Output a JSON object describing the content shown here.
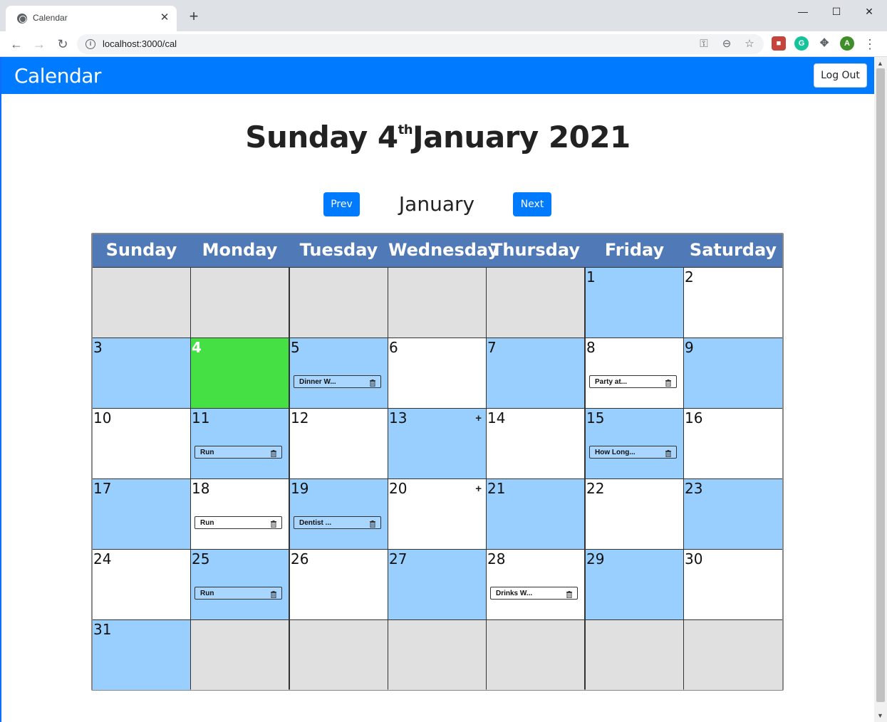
{
  "browser": {
    "tab_title": "Calendar",
    "tab_close": "✕",
    "new_tab": "+",
    "url": "localhost:3000/cal",
    "profile_initial": "A",
    "window": {
      "minimize": "—",
      "maximize": "☐",
      "close": "✕"
    }
  },
  "app": {
    "brand": "Calendar",
    "logout_label": "Log Out"
  },
  "heading": {
    "weekday": "Sunday",
    "day": "4",
    "ordinal": "th",
    "month_year": "January 2021"
  },
  "nav": {
    "prev_label": "Prev",
    "month": "January",
    "next_label": "Next"
  },
  "calendar": {
    "weekdays": [
      "Sunday",
      "Monday",
      "Tuesday",
      "Wednesday",
      "Thursday",
      "Friday",
      "Saturday"
    ],
    "add_symbol": "+",
    "weeks": [
      [
        {
          "day": "",
          "color": "grey"
        },
        {
          "day": "",
          "color": "grey"
        },
        {
          "day": "",
          "color": "grey"
        },
        {
          "day": "",
          "color": "grey"
        },
        {
          "day": "",
          "color": "grey"
        },
        {
          "day": "1",
          "color": "blue"
        },
        {
          "day": "2",
          "color": "white"
        }
      ],
      [
        {
          "day": "3",
          "color": "blue"
        },
        {
          "day": "4",
          "color": "green"
        },
        {
          "day": "5",
          "color": "blue",
          "event": "Dinner W..."
        },
        {
          "day": "6",
          "color": "white"
        },
        {
          "day": "7",
          "color": "blue"
        },
        {
          "day": "8",
          "color": "white",
          "event": "Party at..."
        },
        {
          "day": "9",
          "color": "blue"
        }
      ],
      [
        {
          "day": "10",
          "color": "white"
        },
        {
          "day": "11",
          "color": "blue",
          "event": "Run"
        },
        {
          "day": "12",
          "color": "white"
        },
        {
          "day": "13",
          "color": "blue",
          "plus": true
        },
        {
          "day": "14",
          "color": "white"
        },
        {
          "day": "15",
          "color": "blue",
          "event": "How Long..."
        },
        {
          "day": "16",
          "color": "white"
        }
      ],
      [
        {
          "day": "17",
          "color": "blue"
        },
        {
          "day": "18",
          "color": "white",
          "event": "Run"
        },
        {
          "day": "19",
          "color": "blue",
          "event": "Dentist ..."
        },
        {
          "day": "20",
          "color": "white",
          "plus": true
        },
        {
          "day": "21",
          "color": "blue"
        },
        {
          "day": "22",
          "color": "white"
        },
        {
          "day": "23",
          "color": "blue"
        }
      ],
      [
        {
          "day": "24",
          "color": "white"
        },
        {
          "day": "25",
          "color": "blue",
          "event": "Run"
        },
        {
          "day": "26",
          "color": "white"
        },
        {
          "day": "27",
          "color": "blue"
        },
        {
          "day": "28",
          "color": "white",
          "event": "Drinks W..."
        },
        {
          "day": "29",
          "color": "blue"
        },
        {
          "day": "30",
          "color": "white"
        }
      ],
      [
        {
          "day": "31",
          "color": "blue"
        },
        {
          "day": "",
          "color": "grey"
        },
        {
          "day": "",
          "color": "grey"
        },
        {
          "day": "",
          "color": "grey"
        },
        {
          "day": "",
          "color": "grey"
        },
        {
          "day": "",
          "color": "grey"
        },
        {
          "day": "",
          "color": "grey"
        }
      ]
    ]
  },
  "colors": {
    "navbar": "#007bff",
    "weekday_header": "#5079b8",
    "cell_blue": "#99cfff",
    "cell_today": "#44e044",
    "cell_empty": "#e0e0e0"
  }
}
